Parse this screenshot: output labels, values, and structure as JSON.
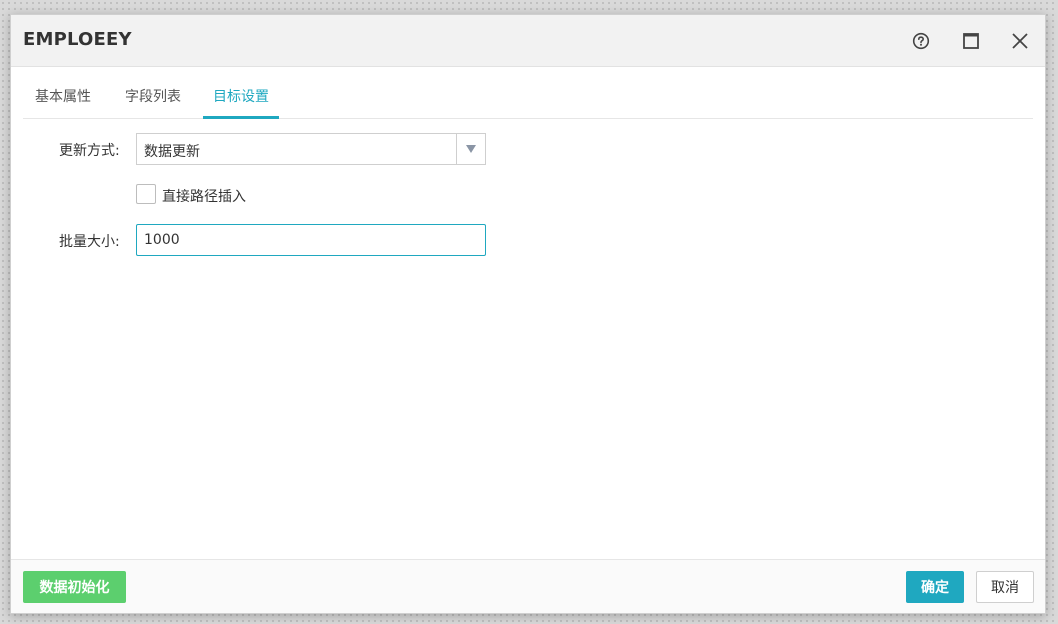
{
  "dialog": {
    "title": "EMPLOEEY",
    "icons": {
      "help": "help-circle-icon",
      "maximize": "maximize-icon",
      "close": "close-icon"
    }
  },
  "tabs": [
    {
      "label": "基本属性",
      "active": false
    },
    {
      "label": "字段列表",
      "active": false
    },
    {
      "label": "目标设置",
      "active": true
    }
  ],
  "form": {
    "update_mode": {
      "label": "更新方式:",
      "value": "数据更新"
    },
    "direct_path": {
      "label": "直接路径插入",
      "checked": false
    },
    "batch_size": {
      "label": "批量大小:",
      "value": "1000"
    }
  },
  "footer": {
    "init_label": "数据初始化",
    "ok_label": "确定",
    "cancel_label": "取消"
  },
  "colors": {
    "accent": "#1fa8c0",
    "init_button": "#5ccf6e"
  }
}
